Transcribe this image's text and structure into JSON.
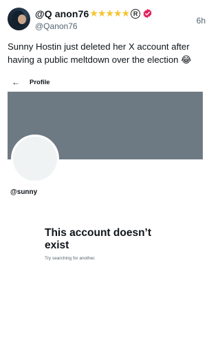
{
  "post": {
    "display_name": "@Q anon76",
    "stars": "★★★★★",
    "registered_mark": "R",
    "handle": "@Qanon76",
    "timestamp": "6h",
    "text": "Sunny Hostin just deleted her X account after having a public meltdown over the election 😂"
  },
  "embed": {
    "back_icon": "←",
    "title": "Profile",
    "profile_handle": "@sunny",
    "empty_title": "This account doesn’t exist",
    "empty_subtitle": "Try searching for another."
  },
  "colors": {
    "banner": "#6e7a83",
    "stars": "#f5c531",
    "verified_badge": "#e0245e",
    "secondary_text": "#536471"
  }
}
